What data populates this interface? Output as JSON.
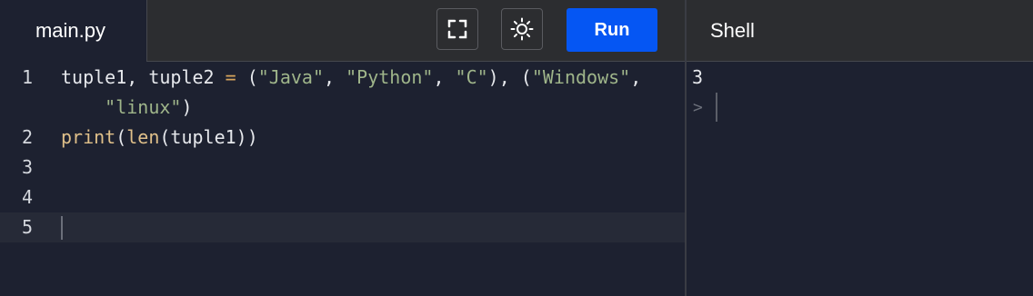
{
  "editor": {
    "file_tab": "main.py",
    "lines": [
      {
        "num": "1",
        "tokens": [
          {
            "t": "tuple1, tuple2 ",
            "c": "plain"
          },
          {
            "t": "=",
            "c": "op"
          },
          {
            "t": " (",
            "c": "plain"
          },
          {
            "t": "\"Java\"",
            "c": "str"
          },
          {
            "t": ", ",
            "c": "plain"
          },
          {
            "t": "\"Python\"",
            "c": "str"
          },
          {
            "t": ", ",
            "c": "plain"
          },
          {
            "t": "\"C\"",
            "c": "str"
          },
          {
            "t": "), (",
            "c": "plain"
          },
          {
            "t": "\"Windows\"",
            "c": "str"
          },
          {
            "t": ",",
            "c": "plain"
          }
        ]
      },
      {
        "num": "",
        "tokens": [
          {
            "t": "    ",
            "c": "plain"
          },
          {
            "t": "\"linux\"",
            "c": "str"
          },
          {
            "t": ")",
            "c": "plain"
          }
        ]
      },
      {
        "num": "2",
        "tokens": [
          {
            "t": "print",
            "c": "fn"
          },
          {
            "t": "(",
            "c": "plain"
          },
          {
            "t": "len",
            "c": "fn"
          },
          {
            "t": "(tuple1))",
            "c": "plain"
          }
        ]
      },
      {
        "num": "3",
        "tokens": []
      },
      {
        "num": "4",
        "tokens": []
      },
      {
        "num": "5",
        "tokens": []
      }
    ],
    "active_line_index": 5
  },
  "toolbar": {
    "fullscreen_icon": "fullscreen-icon",
    "theme_icon": "sun-icon",
    "run_label": "Run"
  },
  "shell": {
    "title": "Shell",
    "output": "3",
    "prompt": ">"
  },
  "colors": {
    "run_button": "#0556f3",
    "background": "#1d2130",
    "string": "#9fb58a"
  }
}
